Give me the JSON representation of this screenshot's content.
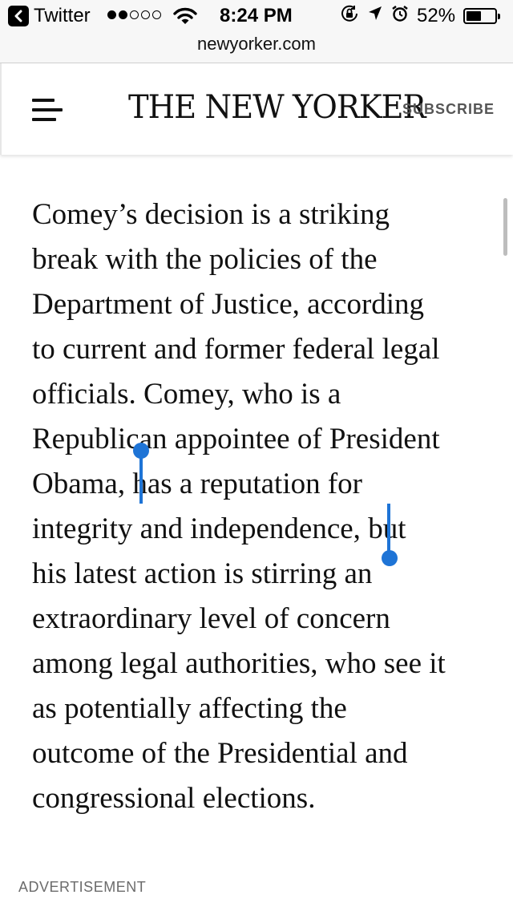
{
  "status_bar": {
    "back_app": "Twitter",
    "time": "8:24 PM",
    "battery_percent": "52%",
    "battery_level": 0.52,
    "signal_bars_filled": 2,
    "signal_bars_total": 5
  },
  "url_bar": {
    "domain": "newyorker.com"
  },
  "header": {
    "logo": "THE NEW YORKER",
    "subscribe_label": "SUBSCRIBE"
  },
  "article": {
    "lines": [
      "Comey’s decision is a striking",
      "break with the policies of the",
      "Department of Justice, according",
      "to current and former federal legal",
      "officials. Comey, who is a",
      "Republican appointee of President",
      "Obama, ",
      "has a reputation for",
      "integrity and independence,",
      " but",
      "his latest action is stirring an",
      "extraordinary level of concern",
      "among legal authorities, who see it",
      "as potentially affecting the",
      "outcome of the Presidential and",
      "congressional elections."
    ],
    "selected_text": "has a reputation for integrity and independence,"
  },
  "ad_label": "ADVERTISEMENT",
  "colors": {
    "selection_highlight": "#c9ddef",
    "selection_handle": "#1e74d6",
    "chrome_bg": "#f7f7f7"
  },
  "icons": [
    "back-chevron-icon",
    "wifi-icon",
    "rotation-lock-icon",
    "location-arrow-icon",
    "alarm-icon",
    "battery-icon",
    "menu-icon"
  ]
}
